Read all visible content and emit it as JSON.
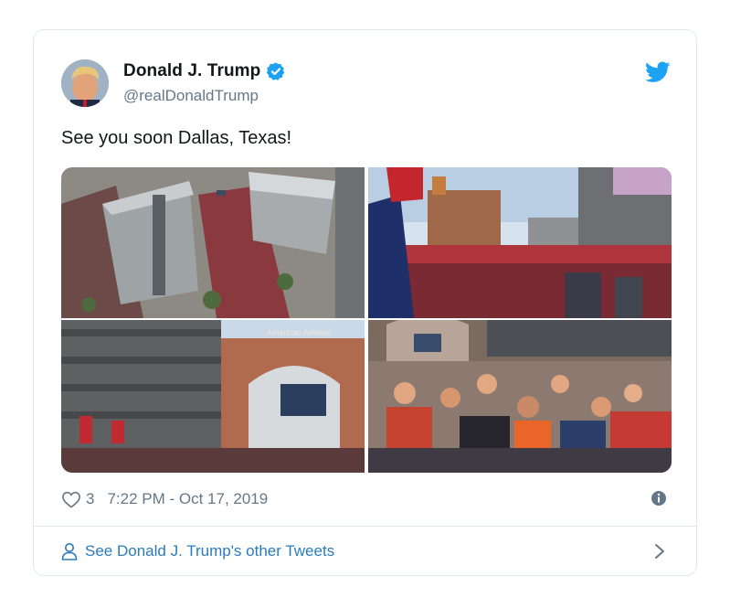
{
  "tweet": {
    "author_name": "Donald J. Trump",
    "author_handle": "@realDonaldTrump",
    "text": "See you soon Dallas, Texas!",
    "likes": "3",
    "timestamp": "7:22 PM - Oct 17, 2019",
    "footer_link": "See Donald J. Trump's other Tweets"
  },
  "icons": {
    "verified": "verified-badge-icon",
    "logo": "twitter-bird-icon",
    "like": "heart-icon",
    "info": "info-icon",
    "profile": "person-icon",
    "chevron": "chevron-right-icon"
  },
  "colors": {
    "accent": "#1da1f2",
    "link": "#2b7bb9",
    "muted": "#657786",
    "border": "#e1e8ed"
  },
  "media": {
    "photos": [
      {
        "sign": ""
      },
      {
        "sign": ""
      },
      {
        "sign": "American Airlines"
      },
      {
        "sign": ""
      }
    ]
  }
}
